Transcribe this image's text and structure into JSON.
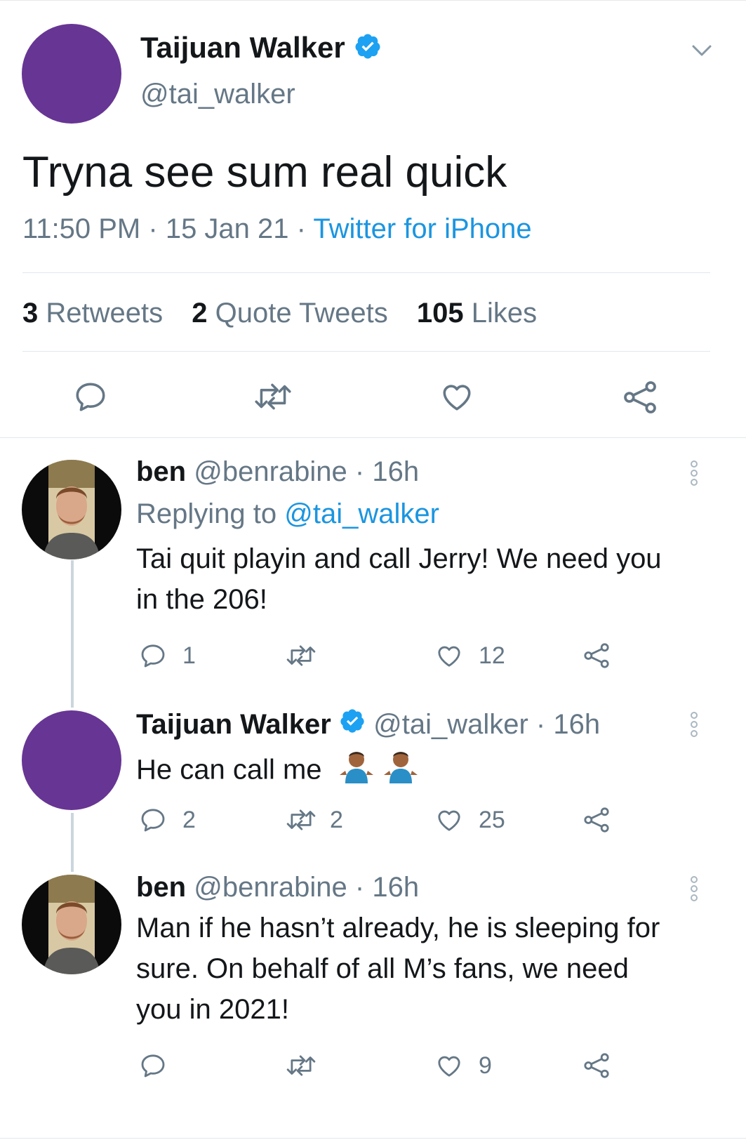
{
  "main_tweet": {
    "author_name": "Taijuan Walker",
    "handle": "@tai_walker",
    "text": "Tryna see sum real quick",
    "time": "11:50 PM",
    "date": "15 Jan 21",
    "source": "Twitter for iPhone",
    "separator": "·",
    "stats": {
      "retweets_count": "3",
      "retweets_label": "Retweets",
      "quotes_count": "2",
      "quotes_label": "Quote Tweets",
      "likes_count": "105",
      "likes_label": "Likes"
    }
  },
  "replies": [
    {
      "author_name": "ben",
      "handle": "@benrabine",
      "time": "· 16h",
      "replying_prefix": "Replying to",
      "replying_handle": "@tai_walker",
      "text_line1": "Tai quit playin and call Jerry! We need you",
      "text_line2": "in the 206!",
      "reply_count": "1",
      "retweet_count": "",
      "like_count": "12"
    },
    {
      "author_name": "Taijuan Walker",
      "handle": "@tai_walker",
      "time": "· 16h",
      "text": "He can call me",
      "reply_count": "2",
      "retweet_count": "2",
      "like_count": "25"
    },
    {
      "author_name": "ben",
      "handle": "@benrabine",
      "time": "· 16h",
      "text_line1": "Man if he hasn’t already, he is sleeping for",
      "text_line2": "sure. On behalf of all M’s fans, we need",
      "text_line3": "you in 2021!",
      "reply_count": "",
      "retweet_count": "",
      "like_count": "9"
    }
  ],
  "colors": {
    "accent": "#1b95e0",
    "avatar_purple": "#673593",
    "muted": "#657786",
    "divider": "#e1e8ed"
  },
  "icons": [
    "verified-badge-icon",
    "chevron-down-icon",
    "reply-icon",
    "retweet-icon",
    "like-icon",
    "share-icon",
    "more-vertical-icon",
    "shrug-emoji-icon"
  ]
}
